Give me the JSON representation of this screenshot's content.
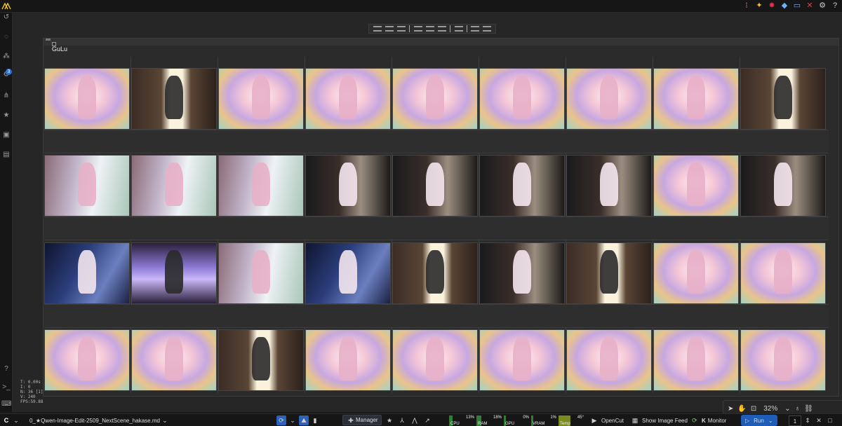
{
  "workflow_tab": {
    "label": "0_★Qwen-Image-Edit-2509_NextScene_hakase.md"
  },
  "node": {
    "title": "GuLu"
  },
  "stats": [
    "T: 0.00s",
    "I: 0",
    "N: 36 [1]",
    "V: 240",
    "FPS:59.88"
  ],
  "canvas": {
    "zoom": "32%"
  },
  "sidebar": {
    "queue_badge": "3"
  },
  "toolbar": {
    "manager": "Manager",
    "opencut": "OpenCut",
    "show_image_feed": "Show Image Feed",
    "monitor": "Monitor",
    "run": "Run",
    "run_count": "1"
  },
  "resource_monitor": [
    {
      "label": "CPU",
      "value": "13%",
      "fraction": 0.13,
      "color": "#2e7d32"
    },
    {
      "label": "RAM",
      "value": "18%",
      "fraction": 0.18,
      "color": "#2e7d32"
    },
    {
      "label": "GPU",
      "value": "0%",
      "fraction": 0.0,
      "color": "#2e7d32"
    },
    {
      "label": "VRAM",
      "value": "1%",
      "fraction": 0.01,
      "color": "#2e7d32"
    },
    {
      "label": "Temp",
      "value": "45°",
      "fraction": 0.45,
      "color": "#7a8a1e"
    }
  ],
  "thumbnails": [
    [
      "floral-rose-frame",
      "figure-door",
      "floral-rose-frame",
      "floral-rose-frame",
      "floral-rose-frame",
      "floral-rose-frame",
      "floral-rose-frame",
      "floral-rose-frame",
      "figure-door"
    ],
    [
      "window-room",
      "window-room",
      "window-room",
      "dark-bookshelf-room",
      "dark-bookshelf-room",
      "dark-bookshelf-room",
      "dark-bookshelf-room",
      "floral-rose-frame",
      "dark-bookshelf-room"
    ],
    [
      "dark-blue-room",
      "purple-screen",
      "window-room",
      "dark-blue-room",
      "figure-door",
      "dark-bookshelf-room",
      "figure-door",
      "floral-rose-frame",
      "floral-rose-frame"
    ],
    [
      "floral-rose-frame",
      "floral-rose-frame",
      "figure-door",
      "floral-rose-frame",
      "floral-rose-frame",
      "floral-rose-frame",
      "floral-rose-frame",
      "floral-rose-frame",
      "floral-rose-frame"
    ]
  ]
}
